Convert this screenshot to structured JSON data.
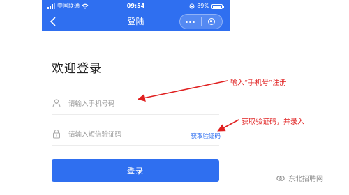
{
  "status_bar": {
    "carrier": "中国联通",
    "time": "09:54",
    "battery": "89%"
  },
  "nav": {
    "title": "登陆"
  },
  "login": {
    "welcome": "欢迎登录",
    "phone_placeholder": "请输入手机号码",
    "code_placeholder": "请输入短信验证码",
    "get_code": "获取验证码",
    "submit": "登录"
  },
  "annotations": {
    "phone_note": "输入“手机号”注册",
    "code_note": "获取验证码，并录入"
  },
  "watermark": {
    "text": "东北招聘网"
  },
  "colors": {
    "primary": "#2f6ff0",
    "annotation": "#e02020"
  }
}
